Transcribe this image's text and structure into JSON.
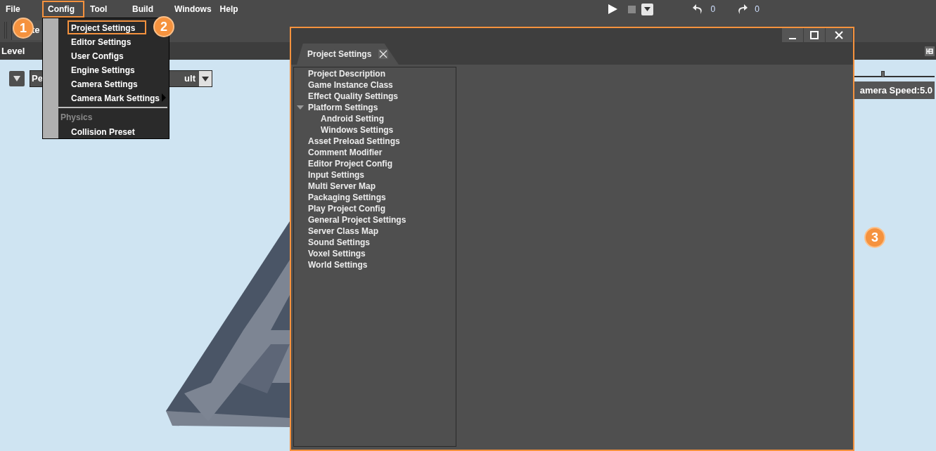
{
  "menu_bar": {
    "items": [
      {
        "label": "File",
        "highlighted": false
      },
      {
        "label": "Config",
        "highlighted": true
      },
      {
        "label": "Tool",
        "highlighted": false
      },
      {
        "label": "Build",
        "highlighted": false
      },
      {
        "label": "Windows",
        "highlighted": false
      },
      {
        "label": "Help",
        "highlighted": false
      }
    ],
    "undo_count": "0",
    "redo_count": "0"
  },
  "toolbar": {
    "button_text": "te"
  },
  "panel": {
    "title": "Level"
  },
  "viewport": {
    "view_left": "Pe",
    "view_right": "ult",
    "camera_speed": "amera Speed:5.0",
    "speed_slider": {
      "level": 0.4
    }
  },
  "config_menu": {
    "items": [
      {
        "kind": "item",
        "label": "Project Settings",
        "highlighted": true
      },
      {
        "kind": "item",
        "label": "Editor Settings",
        "highlighted": false
      },
      {
        "kind": "item",
        "label": "User Configs",
        "highlighted": false
      },
      {
        "kind": "item",
        "label": "Engine Settings",
        "highlighted": false
      },
      {
        "kind": "item",
        "label": "Camera Settings",
        "highlighted": false
      },
      {
        "kind": "submenu",
        "label": "Camera Mark Settings",
        "highlighted": false
      },
      {
        "kind": "separator"
      },
      {
        "kind": "header",
        "label": "Physics"
      },
      {
        "kind": "item",
        "label": "Collision Preset",
        "highlighted": false
      }
    ]
  },
  "dialog": {
    "tab": "Project Settings",
    "tree": [
      {
        "label": "Project Description"
      },
      {
        "label": "Game Instance Class"
      },
      {
        "label": "Effect Quality Settings"
      },
      {
        "label": "Platform Settings",
        "expanded": true,
        "children": [
          {
            "label": "Android Setting"
          },
          {
            "label": "Windows Settings"
          }
        ]
      },
      {
        "label": "Asset Preload Settings"
      },
      {
        "label": "Comment Modifier"
      },
      {
        "label": "Editor Project Config"
      },
      {
        "label": "Input Settings"
      },
      {
        "label": "Multi Server Map"
      },
      {
        "label": "Packaging Settings"
      },
      {
        "label": "Play Project Config"
      },
      {
        "label": "General Project Settings"
      },
      {
        "label": "Server Class Map"
      },
      {
        "label": "Sound Settings"
      },
      {
        "label": "Voxel Settings"
      },
      {
        "label": "World Settings"
      }
    ]
  },
  "callouts": [
    "1",
    "2",
    "3"
  ]
}
